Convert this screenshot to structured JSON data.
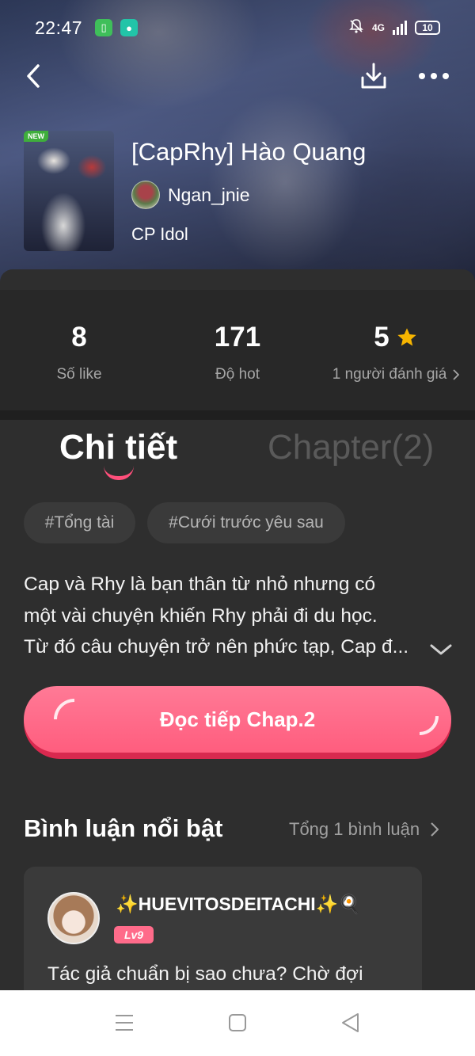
{
  "status_bar": {
    "time": "22:47",
    "network": "4G",
    "battery": "10",
    "icons": [
      "app-notification-icon",
      "chat-notification-icon",
      "bell-muted-icon",
      "signal-icon",
      "battery-icon"
    ]
  },
  "header": {
    "back_icon": "chevron-left-icon",
    "download_icon": "download-icon",
    "more_icon": "more-horizontal-icon"
  },
  "story": {
    "badge": "NEW",
    "title": "[CapRhy] Hào Quang",
    "author": "Ngan_jnie",
    "category": "CP Idol"
  },
  "stats": {
    "likes": {
      "value": "8",
      "label": "Số like"
    },
    "hot": {
      "value": "171",
      "label": "Độ hot"
    },
    "rating": {
      "value": "5",
      "label": "1 người đánh giá",
      "star_color": "#f7b500"
    }
  },
  "tabs": {
    "detail": "Chi tiết",
    "chapter": "Chapter(2)",
    "active": "detail",
    "accent": "#ff4f7b"
  },
  "tags": [
    "#Tổng tài",
    "#Cưới trước yêu sau"
  ],
  "description": {
    "lines": [
      "Cap và Rhy là bạn thân từ nhỏ nhưng có",
      "một vài chuyện khiến Rhy phải đi du học.",
      "Từ đó câu chuyện trở nên phức tạp, Cap đ..."
    ]
  },
  "continue_button": {
    "label": "Đọc tiếp Chap.2",
    "color": "#ff5d7e"
  },
  "comments": {
    "title": "Bình luận nổi bật",
    "total": "Tổng 1 bình luận",
    "items": [
      {
        "user": "✨HUEVITOSDEITACHI✨🍳",
        "level": "Lv9",
        "text": "Tác giả chuẩn bị sao chưa? Chờ đợi"
      }
    ]
  },
  "system_nav": {
    "icons": [
      "menu-icon",
      "home-square-icon",
      "back-triangle-icon"
    ]
  }
}
